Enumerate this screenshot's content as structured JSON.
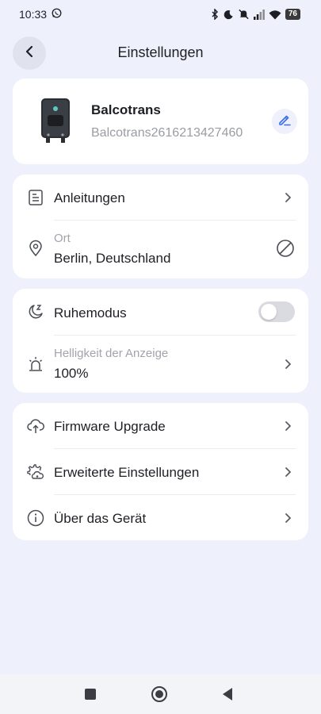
{
  "status_bar": {
    "time": "10:33",
    "battery": "76"
  },
  "header": {
    "title": "Einstellungen"
  },
  "device": {
    "name": "Balcotrans",
    "serial": "Balcotrans2616213427460"
  },
  "group1": {
    "manual_label": "Anleitungen",
    "location_label": "Ort",
    "location_value": "Berlin, Deutschland"
  },
  "group2": {
    "sleep_label": "Ruhemodus",
    "sleep_enabled": false,
    "brightness_label": "Helligkeit der Anzeige",
    "brightness_value": "100%"
  },
  "group3": {
    "firmware_label": "Firmware Upgrade",
    "advanced_label": "Erweiterte Einstellungen",
    "about_label": "Über das Gerät"
  },
  "icons": {
    "back": "chevron-left-icon",
    "edit": "pencil-icon",
    "manual": "document-icon",
    "location": "map-pin-icon",
    "no_location": "prohibit-icon",
    "sleep": "moon-z-icon",
    "brightness": "alarm-light-icon",
    "firmware": "cloud-upload-icon",
    "advanced": "gear-cloud-icon",
    "about": "info-icon"
  },
  "colors": {
    "accent": "#3a6fe6",
    "background": "#eef1fb"
  }
}
